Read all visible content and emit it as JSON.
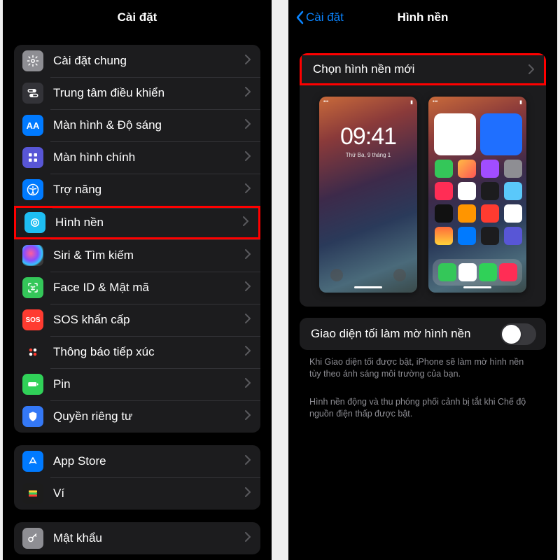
{
  "left": {
    "title": "Cài đặt",
    "groups": [
      [
        {
          "label": "Cài đặt chung",
          "icon": "gear-icon",
          "bg": "bg-grey"
        },
        {
          "label": "Trung tâm điều khiển",
          "icon": "switches-icon",
          "bg": "bg-grey2"
        },
        {
          "label": "Màn hình & Độ sáng",
          "icon": "text-size-icon",
          "bg": "bg-blue",
          "glyph": "AA"
        },
        {
          "label": "Màn hình chính",
          "icon": "grid-icon",
          "bg": "bg-purple"
        },
        {
          "label": "Trợ năng",
          "icon": "accessibility-icon",
          "bg": "bg-blue"
        },
        {
          "label": "Hình nền",
          "icon": "wallpaper-icon",
          "bg": "bg-cyan",
          "highlight": true
        },
        {
          "label": "Siri & Tìm kiếm",
          "icon": "siri-icon",
          "bg": "bg-siri"
        },
        {
          "label": "Face ID & Mật mã",
          "icon": "faceid-icon",
          "bg": "bg-green"
        },
        {
          "label": "SOS khẩn cấp",
          "icon": "sos-icon",
          "bg": "bg-red",
          "glyph": "SOS"
        },
        {
          "label": "Thông báo tiếp xúc",
          "icon": "exposure-icon",
          "bg": "bg-dots"
        },
        {
          "label": "Pin",
          "icon": "battery-icon",
          "bg": "bg-green2"
        },
        {
          "label": "Quyền riêng tư",
          "icon": "privacy-icon",
          "bg": "bg-blue2"
        }
      ],
      [
        {
          "label": "App Store",
          "icon": "appstore-icon",
          "bg": "bg-blue"
        },
        {
          "label": "Ví",
          "icon": "wallet-icon",
          "bg": "bg-wallet"
        }
      ],
      [
        {
          "label": "Mật khẩu",
          "icon": "key-icon",
          "bg": "bg-grey"
        }
      ]
    ]
  },
  "right": {
    "back_label": "Cài đặt",
    "title": "Hình nền",
    "choose_new": "Chọn hình nền mới",
    "lockscreen": {
      "time": "09:41",
      "date": "Thứ Ba, 9 tháng 1"
    },
    "dark_dim_label": "Giao diện tối làm mờ hình nền",
    "dark_dim_on": false,
    "note1": "Khi Giao diện tối được bật, iPhone sẽ làm mờ hình nền tùy theo ánh sáng môi trường của bạn.",
    "note2": "Hình nền động và thu phóng phối cảnh bị tắt khi Chế độ nguồn điện thấp được bật."
  }
}
